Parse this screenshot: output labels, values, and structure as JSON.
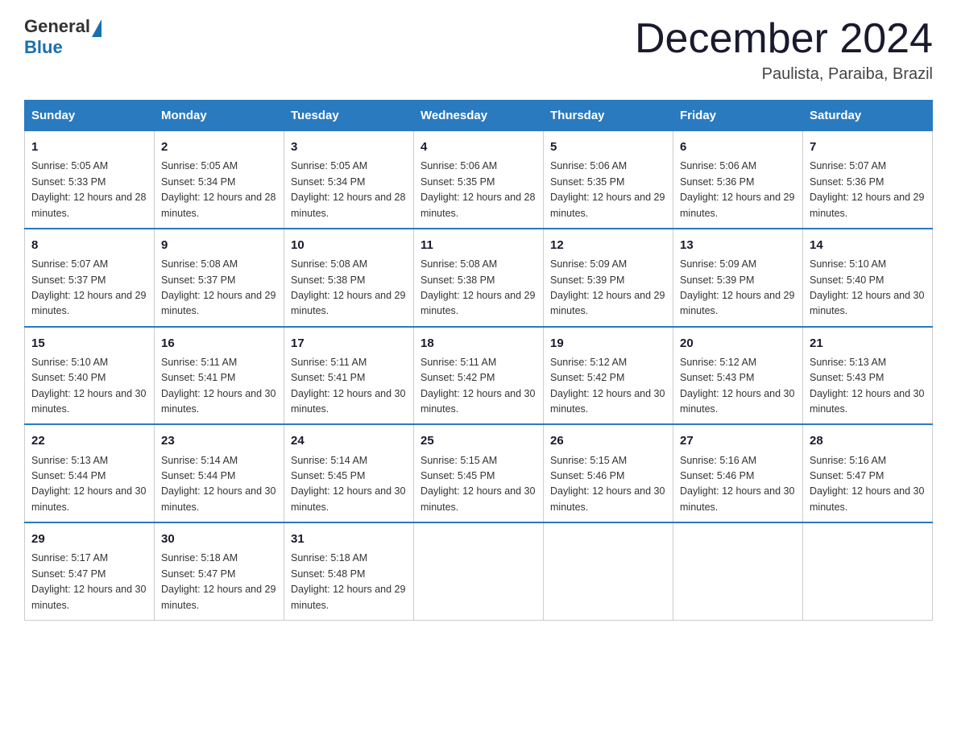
{
  "logo": {
    "general": "General",
    "blue": "Blue"
  },
  "title": "December 2024",
  "location": "Paulista, Paraiba, Brazil",
  "days_of_week": [
    "Sunday",
    "Monday",
    "Tuesday",
    "Wednesday",
    "Thursday",
    "Friday",
    "Saturday"
  ],
  "weeks": [
    [
      {
        "day": "1",
        "sunrise": "5:05 AM",
        "sunset": "5:33 PM",
        "daylight": "12 hours and 28 minutes."
      },
      {
        "day": "2",
        "sunrise": "5:05 AM",
        "sunset": "5:34 PM",
        "daylight": "12 hours and 28 minutes."
      },
      {
        "day": "3",
        "sunrise": "5:05 AM",
        "sunset": "5:34 PM",
        "daylight": "12 hours and 28 minutes."
      },
      {
        "day": "4",
        "sunrise": "5:06 AM",
        "sunset": "5:35 PM",
        "daylight": "12 hours and 28 minutes."
      },
      {
        "day": "5",
        "sunrise": "5:06 AM",
        "sunset": "5:35 PM",
        "daylight": "12 hours and 29 minutes."
      },
      {
        "day": "6",
        "sunrise": "5:06 AM",
        "sunset": "5:36 PM",
        "daylight": "12 hours and 29 minutes."
      },
      {
        "day": "7",
        "sunrise": "5:07 AM",
        "sunset": "5:36 PM",
        "daylight": "12 hours and 29 minutes."
      }
    ],
    [
      {
        "day": "8",
        "sunrise": "5:07 AM",
        "sunset": "5:37 PM",
        "daylight": "12 hours and 29 minutes."
      },
      {
        "day": "9",
        "sunrise": "5:08 AM",
        "sunset": "5:37 PM",
        "daylight": "12 hours and 29 minutes."
      },
      {
        "day": "10",
        "sunrise": "5:08 AM",
        "sunset": "5:38 PM",
        "daylight": "12 hours and 29 minutes."
      },
      {
        "day": "11",
        "sunrise": "5:08 AM",
        "sunset": "5:38 PM",
        "daylight": "12 hours and 29 minutes."
      },
      {
        "day": "12",
        "sunrise": "5:09 AM",
        "sunset": "5:39 PM",
        "daylight": "12 hours and 29 minutes."
      },
      {
        "day": "13",
        "sunrise": "5:09 AM",
        "sunset": "5:39 PM",
        "daylight": "12 hours and 29 minutes."
      },
      {
        "day": "14",
        "sunrise": "5:10 AM",
        "sunset": "5:40 PM",
        "daylight": "12 hours and 30 minutes."
      }
    ],
    [
      {
        "day": "15",
        "sunrise": "5:10 AM",
        "sunset": "5:40 PM",
        "daylight": "12 hours and 30 minutes."
      },
      {
        "day": "16",
        "sunrise": "5:11 AM",
        "sunset": "5:41 PM",
        "daylight": "12 hours and 30 minutes."
      },
      {
        "day": "17",
        "sunrise": "5:11 AM",
        "sunset": "5:41 PM",
        "daylight": "12 hours and 30 minutes."
      },
      {
        "day": "18",
        "sunrise": "5:11 AM",
        "sunset": "5:42 PM",
        "daylight": "12 hours and 30 minutes."
      },
      {
        "day": "19",
        "sunrise": "5:12 AM",
        "sunset": "5:42 PM",
        "daylight": "12 hours and 30 minutes."
      },
      {
        "day": "20",
        "sunrise": "5:12 AM",
        "sunset": "5:43 PM",
        "daylight": "12 hours and 30 minutes."
      },
      {
        "day": "21",
        "sunrise": "5:13 AM",
        "sunset": "5:43 PM",
        "daylight": "12 hours and 30 minutes."
      }
    ],
    [
      {
        "day": "22",
        "sunrise": "5:13 AM",
        "sunset": "5:44 PM",
        "daylight": "12 hours and 30 minutes."
      },
      {
        "day": "23",
        "sunrise": "5:14 AM",
        "sunset": "5:44 PM",
        "daylight": "12 hours and 30 minutes."
      },
      {
        "day": "24",
        "sunrise": "5:14 AM",
        "sunset": "5:45 PM",
        "daylight": "12 hours and 30 minutes."
      },
      {
        "day": "25",
        "sunrise": "5:15 AM",
        "sunset": "5:45 PM",
        "daylight": "12 hours and 30 minutes."
      },
      {
        "day": "26",
        "sunrise": "5:15 AM",
        "sunset": "5:46 PM",
        "daylight": "12 hours and 30 minutes."
      },
      {
        "day": "27",
        "sunrise": "5:16 AM",
        "sunset": "5:46 PM",
        "daylight": "12 hours and 30 minutes."
      },
      {
        "day": "28",
        "sunrise": "5:16 AM",
        "sunset": "5:47 PM",
        "daylight": "12 hours and 30 minutes."
      }
    ],
    [
      {
        "day": "29",
        "sunrise": "5:17 AM",
        "sunset": "5:47 PM",
        "daylight": "12 hours and 30 minutes."
      },
      {
        "day": "30",
        "sunrise": "5:18 AM",
        "sunset": "5:47 PM",
        "daylight": "12 hours and 29 minutes."
      },
      {
        "day": "31",
        "sunrise": "5:18 AM",
        "sunset": "5:48 PM",
        "daylight": "12 hours and 29 minutes."
      },
      null,
      null,
      null,
      null
    ]
  ],
  "labels": {
    "sunrise": "Sunrise: ",
    "sunset": "Sunset: ",
    "daylight": "Daylight: "
  }
}
